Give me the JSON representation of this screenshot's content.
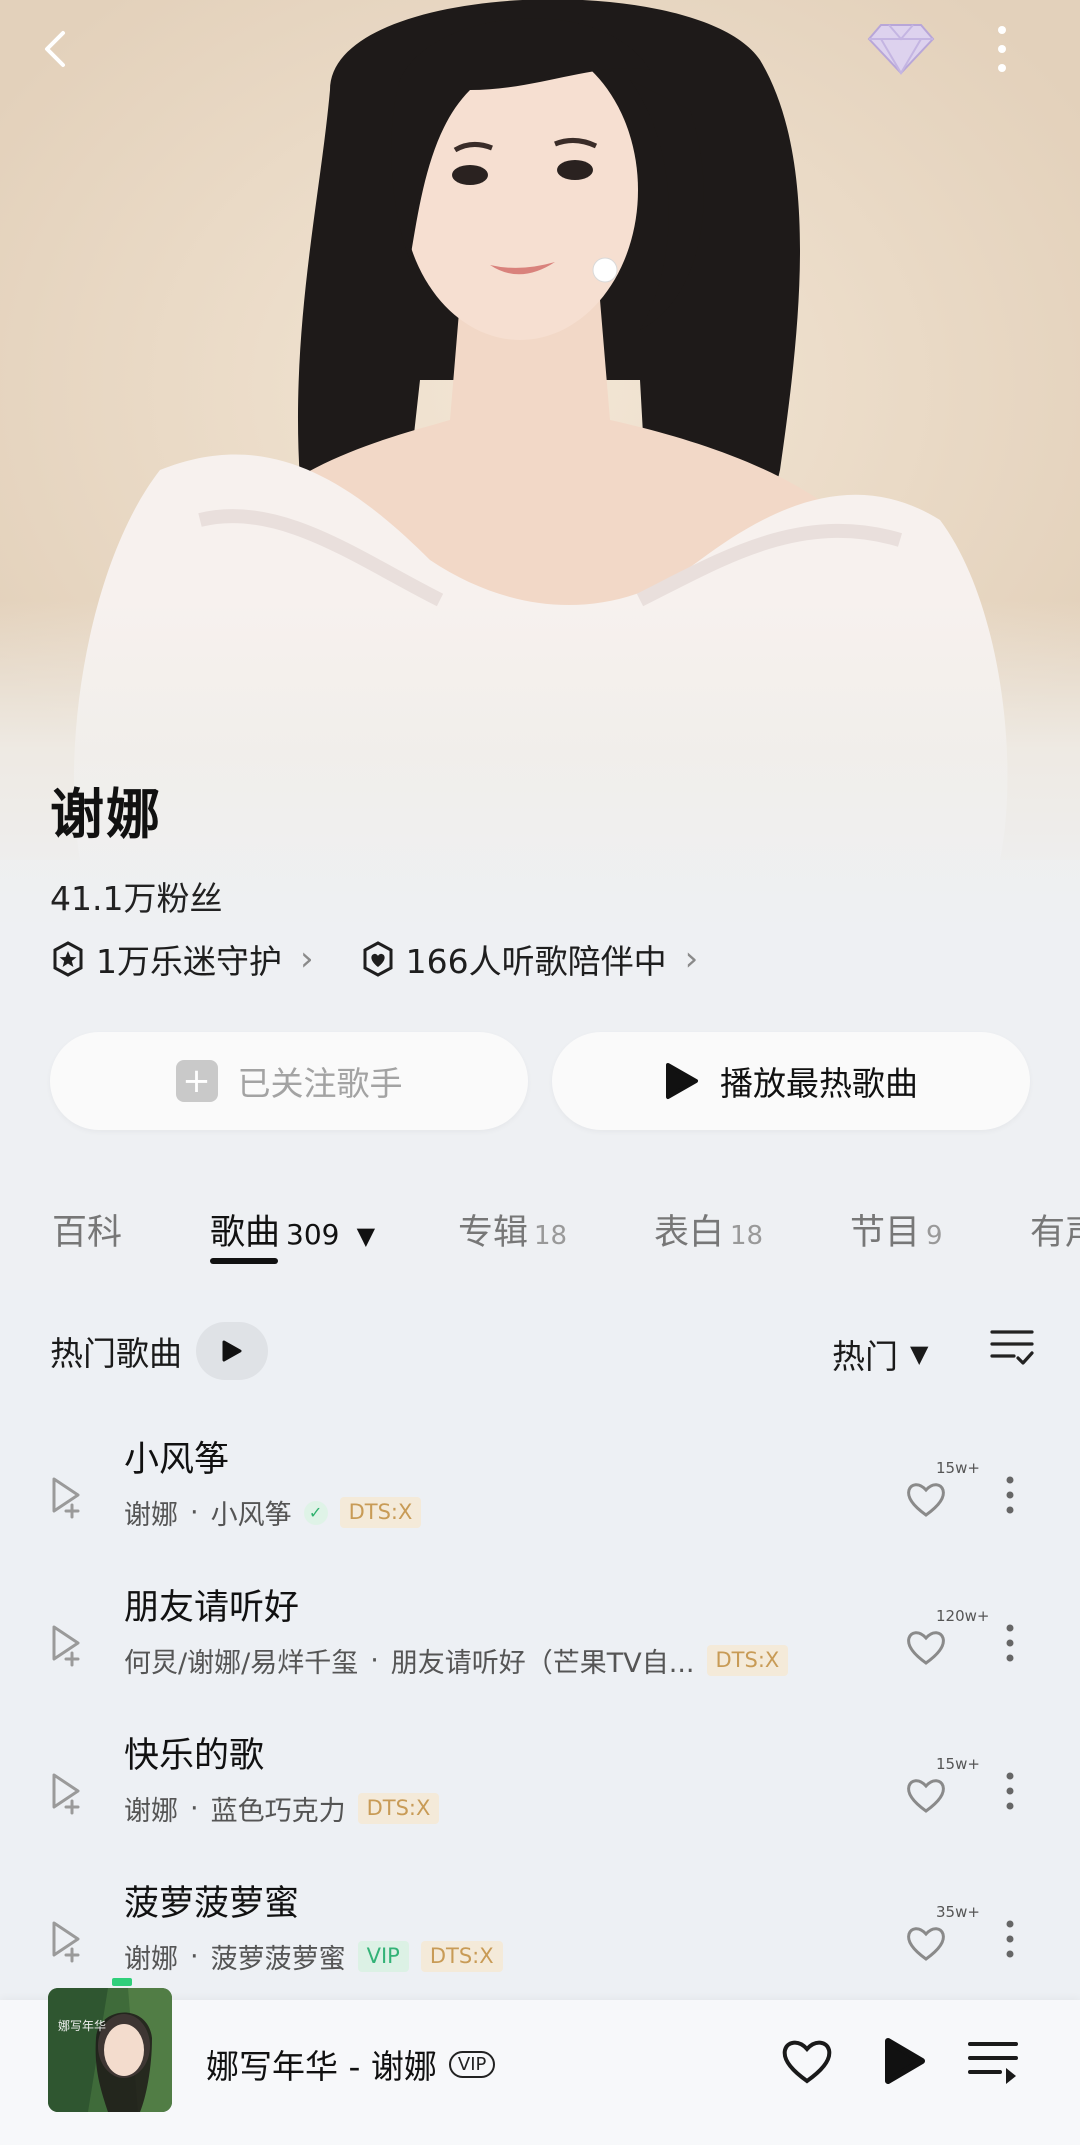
{
  "artist": {
    "name": "谢娜",
    "fans": "41.1万粉丝",
    "stats": [
      {
        "label": "1万乐迷守护"
      },
      {
        "label": "166人听歌陪伴中"
      }
    ]
  },
  "actions": {
    "follow_label": "已关注歌手",
    "play_hot_label": "播放最热歌曲"
  },
  "tabs": [
    {
      "label": "百科",
      "count": ""
    },
    {
      "label": "歌曲",
      "count": "309"
    },
    {
      "label": "专辑",
      "count": "18"
    },
    {
      "label": "表白",
      "count": "18"
    },
    {
      "label": "节目",
      "count": "9"
    },
    {
      "label": "有声",
      "count": ""
    }
  ],
  "list": {
    "title": "热门歌曲",
    "sort_label": "热门"
  },
  "songs": [
    {
      "title": "小风筝",
      "artist": "谢娜",
      "album": "小风筝",
      "badges": [
        "DTS:X"
      ],
      "likes": "15w+"
    },
    {
      "title": "朋友请听好",
      "artist": "何炅/谢娜/易烊千玺",
      "album": "朋友请听好（芒果TV自...",
      "badges": [
        "DTS:X"
      ],
      "likes": "120w+"
    },
    {
      "title": "快乐的歌",
      "artist": "谢娜",
      "album": "蓝色巧克力",
      "badges": [
        "DTS:X"
      ],
      "likes": "15w+"
    },
    {
      "title": "菠萝菠萝蜜",
      "artist": "谢娜",
      "album": "菠萝菠萝蜜",
      "badges": [
        "VIP",
        "DTS:X"
      ],
      "likes": "35w+"
    }
  ],
  "player": {
    "now_playing": "娜写年华 - 谢娜",
    "vip": "VIP",
    "cover_text": "娜写年华"
  },
  "icons": {
    "back": "chevron-left-icon",
    "gem": "diamond-icon",
    "more": "more-vertical-icon",
    "guard": "star-shield-icon",
    "companion": "heart-shield-icon",
    "add_to_playlist": "add-to-playlist-icon",
    "like": "heart-icon",
    "manage": "list-check-icon",
    "playlist": "playlist-icon"
  },
  "colors": {
    "accent_green": "#2fb16d",
    "dts_gold": "#c89b56"
  }
}
